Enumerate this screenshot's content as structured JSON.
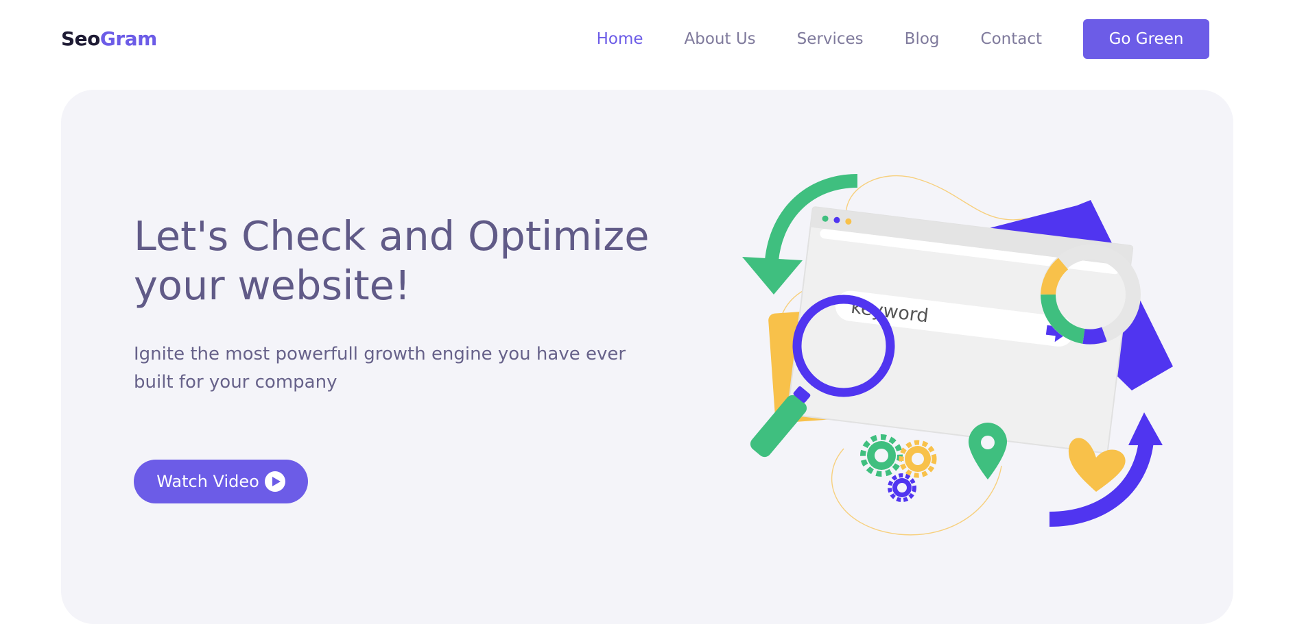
{
  "header": {
    "logo_part1": "Seo",
    "logo_part2": "Gram",
    "nav": [
      {
        "label": "Home",
        "active": true
      },
      {
        "label": "About Us",
        "active": false
      },
      {
        "label": "Services",
        "active": false
      },
      {
        "label": "Blog",
        "active": false
      },
      {
        "label": "Contact",
        "active": false
      }
    ],
    "cta_label": "Go Green"
  },
  "hero": {
    "title_line1": "Let's Check and Optimize",
    "title_line2": "your website!",
    "subtitle_line1": "Ignite the most powerfull growth engine you have ever",
    "subtitle_line2": "built for your company",
    "watch_label": "Watch Video"
  },
  "illustration": {
    "search_text": "keyword"
  },
  "colors": {
    "accent": "#6c5ce7",
    "deep_purple": "#5035f0",
    "green": "#3fbf7f",
    "yellow": "#f8c14a",
    "title_text": "#605a87",
    "hero_bg": "#f4f4f9"
  }
}
